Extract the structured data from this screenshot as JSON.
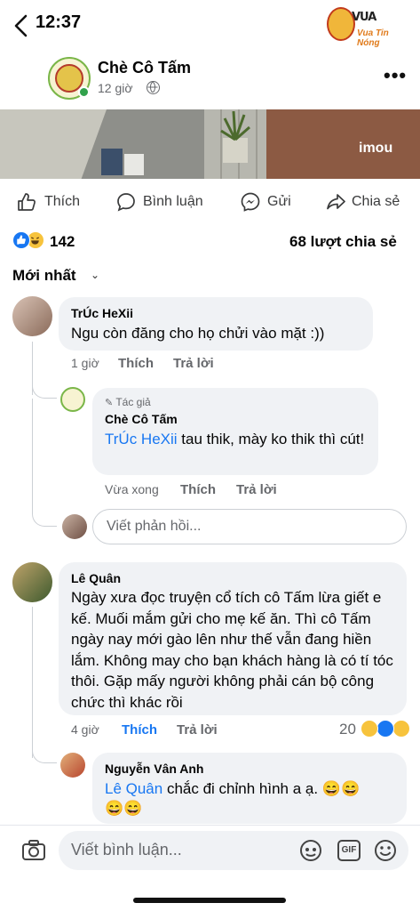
{
  "status_bar": {
    "time": "12:37"
  },
  "watermark": {
    "line1": "VUA",
    "line2": "Vua Tin Nóng"
  },
  "post": {
    "page_name": "Chè Cô Tấm",
    "time": "12 giờ",
    "photo_overlay": "imou"
  },
  "actions": {
    "like": "Thích",
    "comment": "Bình luận",
    "send": "Gửi",
    "share": "Chia sẻ"
  },
  "reactions": {
    "count": "142",
    "shares": "68 lượt chia sẻ"
  },
  "sort": {
    "label": "Mới nhất"
  },
  "comments": [
    {
      "author": "TrÚc HeXii",
      "text": "Ngu còn đăng cho họ chửi vào mặt :))",
      "time": "1 giờ",
      "like": "Thích",
      "reply": "Trả lời"
    },
    {
      "author_badge": "Tác giả",
      "author": "Chè Cô Tấm",
      "mention": "TrÚc HeXii",
      "text": " tau thik, mày ko thik thì cút!",
      "time": "Vừa xong",
      "like": "Thích",
      "reply": "Trả lời"
    },
    {
      "author": "Lê Quân",
      "text": "Ngày xưa đọc truyện cổ tích cô Tấm lừa giết e kế. Muối mắm gửi cho mẹ kế ăn. Thì cô Tấm ngày nay mới gào lên như thế vẫn đang hiền lắm. Không may cho bạn khách hàng là có tí tóc thôi. Gặp mấy người không phải cán bộ công chức thì khác rồi",
      "time": "4 giờ",
      "like": "Thích",
      "reply": "Trả lời",
      "reaction_count": "20"
    },
    {
      "author": "Nguyễn Vân Anh",
      "mention": "Lê Quân",
      "text": " chắc đi chỉnh hình a ạ.",
      "emojis_line1": "😄😄",
      "emojis_line2": "😄😄"
    }
  ],
  "reply_input": {
    "placeholder": "Viết phản hồi..."
  },
  "comment_input": {
    "placeholder": "Viết bình luận..."
  },
  "gif_label": "GIF",
  "colors": {
    "accent": "#1877f2",
    "bubble": "#f0f2f5",
    "meta": "#65676b"
  }
}
